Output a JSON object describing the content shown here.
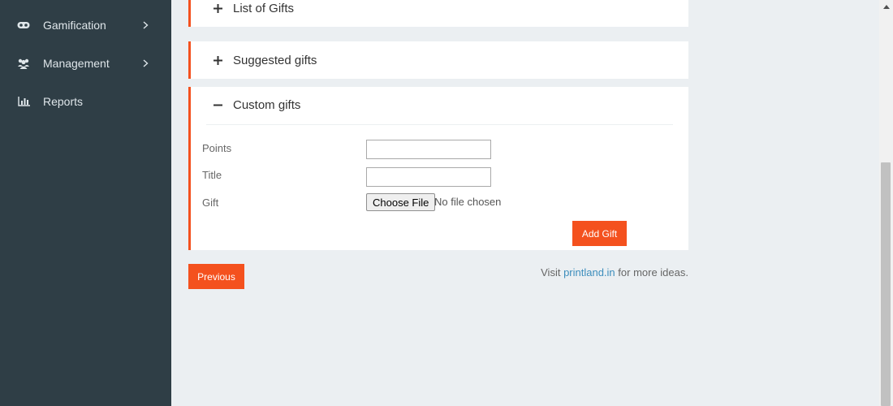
{
  "sidebar": {
    "items": [
      {
        "label": "Gamification",
        "icon": "gamepad-icon",
        "has_submenu": true
      },
      {
        "label": "Management",
        "icon": "users-icon",
        "has_submenu": true
      },
      {
        "label": "Reports",
        "icon": "bar-chart-icon",
        "has_submenu": false
      }
    ]
  },
  "panels": {
    "list_of_gifts": {
      "title": "List of Gifts",
      "state": "collapsed"
    },
    "suggested_gifts": {
      "title": "Suggested gifts",
      "state": "collapsed"
    },
    "custom_gifts": {
      "title": "Custom gifts",
      "state": "expanded",
      "form": {
        "points_label": "Points",
        "points_value": "",
        "title_label": "Title",
        "title_value": "",
        "gift_label": "Gift",
        "choose_file_label": "Choose File",
        "file_status": "No file chosen",
        "add_button": "Add Gift"
      }
    }
  },
  "footer": {
    "previous_button": "Previous",
    "note_prefix": "Visit ",
    "note_link": "printland.in",
    "note_suffix": " for more ideas."
  },
  "colors": {
    "accent": "#f4511e",
    "sidebar_bg": "#2f3e46",
    "page_bg": "#ebeff2",
    "link": "#3c8dbc"
  }
}
